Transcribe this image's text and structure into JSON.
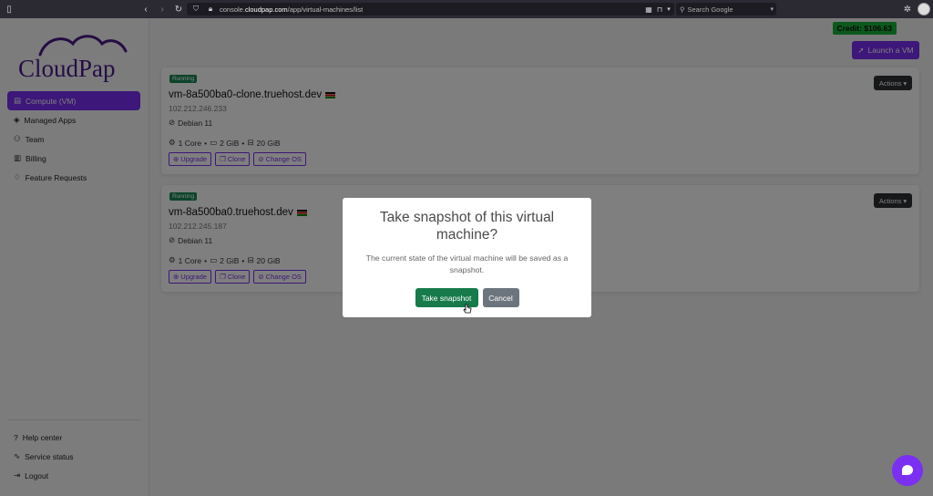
{
  "browser": {
    "url_prefix": "console.",
    "url_domain": "cloudpap.com",
    "url_path": "/app/virtual-machines/list",
    "search_placeholder": "Search Google"
  },
  "sidebar": {
    "logo_text": "CloudPap",
    "items": [
      {
        "label": "Compute (VM)",
        "icon": "database-icon",
        "active": true
      },
      {
        "label": "Managed Apps",
        "icon": "layers-icon",
        "active": false
      },
      {
        "label": "Team",
        "icon": "people-icon",
        "active": false
      },
      {
        "label": "Billing",
        "icon": "receipt-icon",
        "active": false
      },
      {
        "label": "Feature Requests",
        "icon": "lightbulb-icon",
        "active": false
      }
    ],
    "bottom_items": [
      {
        "label": "Help center",
        "icon": "question-icon"
      },
      {
        "label": "Service status",
        "icon": "activity-icon"
      },
      {
        "label": "Logout",
        "icon": "logout-icon"
      }
    ]
  },
  "header": {
    "credit": "Credit: $106.63",
    "launch_label": "Launch a VM"
  },
  "vms": [
    {
      "status": "Running",
      "name": "vm-8a500ba0-clone.truehost.dev",
      "ip": "102.212.246.233",
      "os": "Debian 11",
      "cores": "1 Core",
      "ram": "2 GiB",
      "disk": "20 GiB",
      "actions_label": "Actions",
      "buttons": [
        "Upgrade",
        "Clone",
        "Change OS"
      ]
    },
    {
      "status": "Running",
      "name": "vm-8a500ba0.truehost.dev",
      "ip": "102.212.245.187",
      "os": "Debian 11",
      "cores": "1 Core",
      "ram": "2 GiB",
      "disk": "20 GiB",
      "actions_label": "Actions",
      "buttons": [
        "Upgrade",
        "Clone",
        "Change OS"
      ]
    }
  ],
  "modal": {
    "title": "Take snapshot of this virtual machine?",
    "text": "The current state of the virtual machine will be saved as a snapshot.",
    "confirm_label": "Take snapshot",
    "cancel_label": "Cancel"
  },
  "colors": {
    "brand": "#7b2ff2",
    "logo": "#4a1a86",
    "success": "#198754",
    "credit": "#19b33a"
  }
}
